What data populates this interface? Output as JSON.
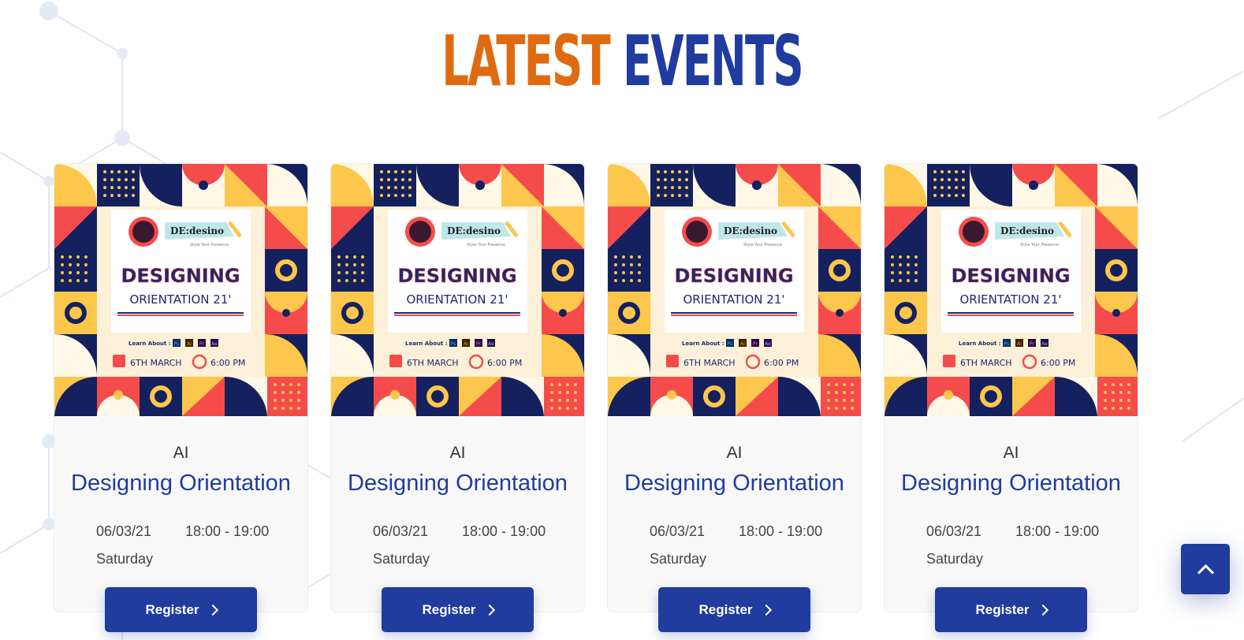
{
  "heading": {
    "word1": "LATEST",
    "word2": "EVENTS"
  },
  "colors": {
    "accent_orange": "#e06a10",
    "brand_blue": "#1f3c9e"
  },
  "events": [
    {
      "category": "AI",
      "title": "Designing Orientation",
      "date": "06/03/21",
      "time": "18:00 - 19:00",
      "day": "Saturday",
      "register_label": "Register",
      "poster": {
        "brand": "DE:desino",
        "tagline": "Style Your Presence",
        "headline": "DESIGNING",
        "subheadline": "ORIENTATION 21'",
        "learn_label": "Learn About :",
        "tools": [
          "Ps",
          "Ai",
          "Pr",
          "Ae"
        ],
        "poster_date": "6TH MARCH",
        "poster_time": "6:00 PM"
      }
    },
    {
      "category": "AI",
      "title": "Designing Orientation",
      "date": "06/03/21",
      "time": "18:00 - 19:00",
      "day": "Saturday",
      "register_label": "Register",
      "poster": {
        "brand": "DE:desino",
        "tagline": "Style Your Presence",
        "headline": "DESIGNING",
        "subheadline": "ORIENTATION 21'",
        "learn_label": "Learn About :",
        "tools": [
          "Ps",
          "Ai",
          "Pr",
          "Ae"
        ],
        "poster_date": "6TH MARCH",
        "poster_time": "6:00 PM"
      }
    },
    {
      "category": "AI",
      "title": "Designing Orientation",
      "date": "06/03/21",
      "time": "18:00 - 19:00",
      "day": "Saturday",
      "register_label": "Register",
      "poster": {
        "brand": "DE:desino",
        "tagline": "Style Your Presence",
        "headline": "DESIGNING",
        "subheadline": "ORIENTATION 21'",
        "learn_label": "Learn About :",
        "tools": [
          "Ps",
          "Ai",
          "Pr",
          "Ae"
        ],
        "poster_date": "6TH MARCH",
        "poster_time": "6:00 PM"
      }
    },
    {
      "category": "AI",
      "title": "Designing Orientation",
      "date": "06/03/21",
      "time": "18:00 - 19:00",
      "day": "Saturday",
      "register_label": "Register",
      "poster": {
        "brand": "DE:desino",
        "tagline": "Style Your Presence",
        "headline": "DESIGNING",
        "subheadline": "ORIENTATION 21'",
        "learn_label": "Learn About :",
        "tools": [
          "Ps",
          "Ai",
          "Pr",
          "Ae"
        ],
        "poster_date": "6TH MARCH",
        "poster_time": "6:00 PM"
      }
    }
  ],
  "scroll_top_icon": "chevron-up-icon"
}
